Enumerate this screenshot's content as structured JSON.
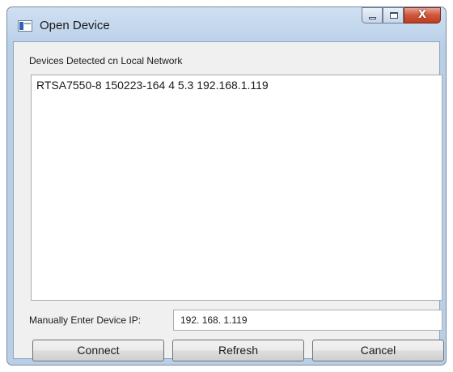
{
  "window": {
    "title": "Open Device"
  },
  "devices": {
    "group_label": "Devices Detected cn Local Network",
    "items": [
      "RTSA7550-8 150223-164 4 5.3 192.168.1.119"
    ]
  },
  "manual": {
    "label": "Manually Enter Device IP:",
    "ip_value": "192. 168. 1.119"
  },
  "buttons": {
    "connect": "Connect",
    "refresh": "Refresh",
    "cancel": "Cancel"
  },
  "caption": {
    "close_glyph": "X"
  },
  "colors": {
    "title_bar": "#c2d6ec",
    "close_button": "#c23a1e",
    "client_bg": "#f0f0f0"
  }
}
